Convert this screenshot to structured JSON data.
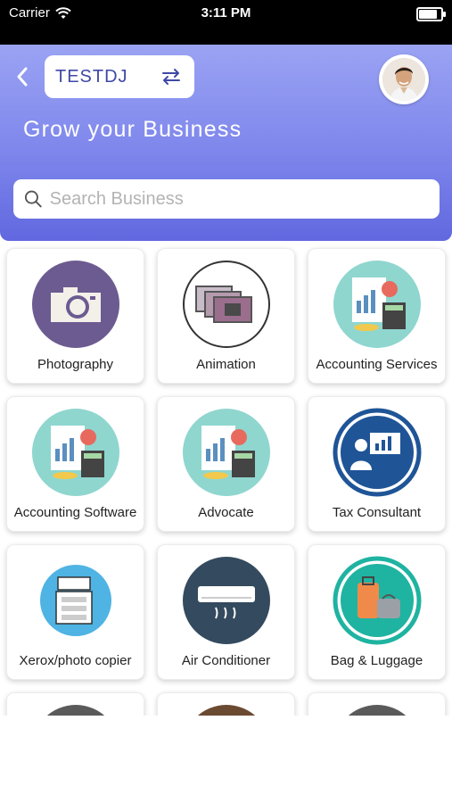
{
  "status_bar": {
    "carrier": "Carrier",
    "time": "3:11 PM"
  },
  "header": {
    "business_name": "TESTDJ",
    "tagline": "Grow your Business",
    "search_placeholder": "Search Business"
  },
  "categories": [
    {
      "label": "Photography",
      "icon": "camera-icon"
    },
    {
      "label": "Animation",
      "icon": "film-strip-icon"
    },
    {
      "label": "Accounting Services",
      "icon": "accounting-icon"
    },
    {
      "label": "Accounting Software",
      "icon": "accounting-icon"
    },
    {
      "label": "Advocate",
      "icon": "accounting-icon"
    },
    {
      "label": "Tax Consultant",
      "icon": "presentation-icon"
    },
    {
      "label": "Xerox/photo copier",
      "icon": "printer-icon"
    },
    {
      "label": "Air Conditioner",
      "icon": "air-conditioner-icon"
    },
    {
      "label": "Bag & Luggage",
      "icon": "luggage-icon"
    }
  ],
  "colors": {
    "header_top": "#9aa3f3",
    "header_bottom": "#6168df",
    "accent_text": "#3f48a6"
  }
}
